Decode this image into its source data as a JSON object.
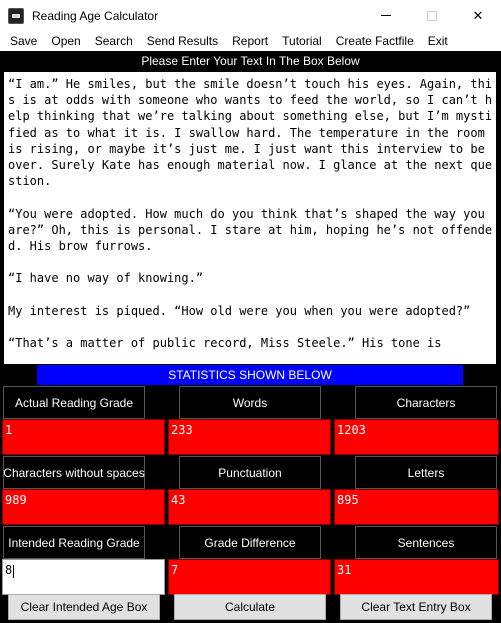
{
  "window": {
    "title": "Reading Age Calculator",
    "minimize": "–",
    "maximize": "□",
    "close": "✕"
  },
  "menu": [
    "Save",
    "Open",
    "Search",
    "Send Results",
    "Report",
    "Tutorial",
    "Create Factfile",
    "Exit"
  ],
  "prompt": "Please Enter Your Text In The Box Below",
  "text_entry": [
    "“I am.” He smiles, but the smile doesn’t touch his eyes. Again, this is at odds with someone who wants to feed the world, so I can’t help thinking that we’re talking about something else, but I’m mystified as to what it is. I swallow hard. The temperature in the room is rising, or maybe it’s just me. I just want this interview to be over. Surely Kate has enough material now. I glance at the next question.",
    "“You were adopted. How much do you think that’s shaped the way you are?” Oh, this is personal. I stare at him, hoping he’s not offended. His brow furrows.",
    "“I have no way of knowing.”",
    "My interest is piqued. “How old were you when you were adopted?”",
    "“That’s a matter of public record, Miss Steele.” His tone is"
  ],
  "stats_banner": "STATISTICS SHOWN BELOW",
  "stats": {
    "actual_reading_grade": {
      "label": "Actual Reading Grade",
      "value": "1"
    },
    "words": {
      "label": "Words",
      "value": "233"
    },
    "characters": {
      "label": "Characters",
      "value": "1203"
    },
    "characters_without_spaces": {
      "label": "Characters without spaces",
      "value": "989"
    },
    "punctuation": {
      "label": "Punctuation",
      "value": "43"
    },
    "letters": {
      "label": "Letters",
      "value": "895"
    },
    "intended_reading_grade": {
      "label": "Intended Reading Grade",
      "value": "8"
    },
    "grade_difference": {
      "label": "Grade Difference",
      "value": "7"
    },
    "sentences": {
      "label": "Sentences",
      "value": "31"
    }
  },
  "buttons": {
    "clear_intended": "Clear Intended Age Box",
    "calculate": "Calculate",
    "clear_text": "Clear Text Entry Box"
  },
  "colors": {
    "value_bg": "#ff0000",
    "banner_bg": "#0000ff",
    "window_bg": "#000000"
  }
}
